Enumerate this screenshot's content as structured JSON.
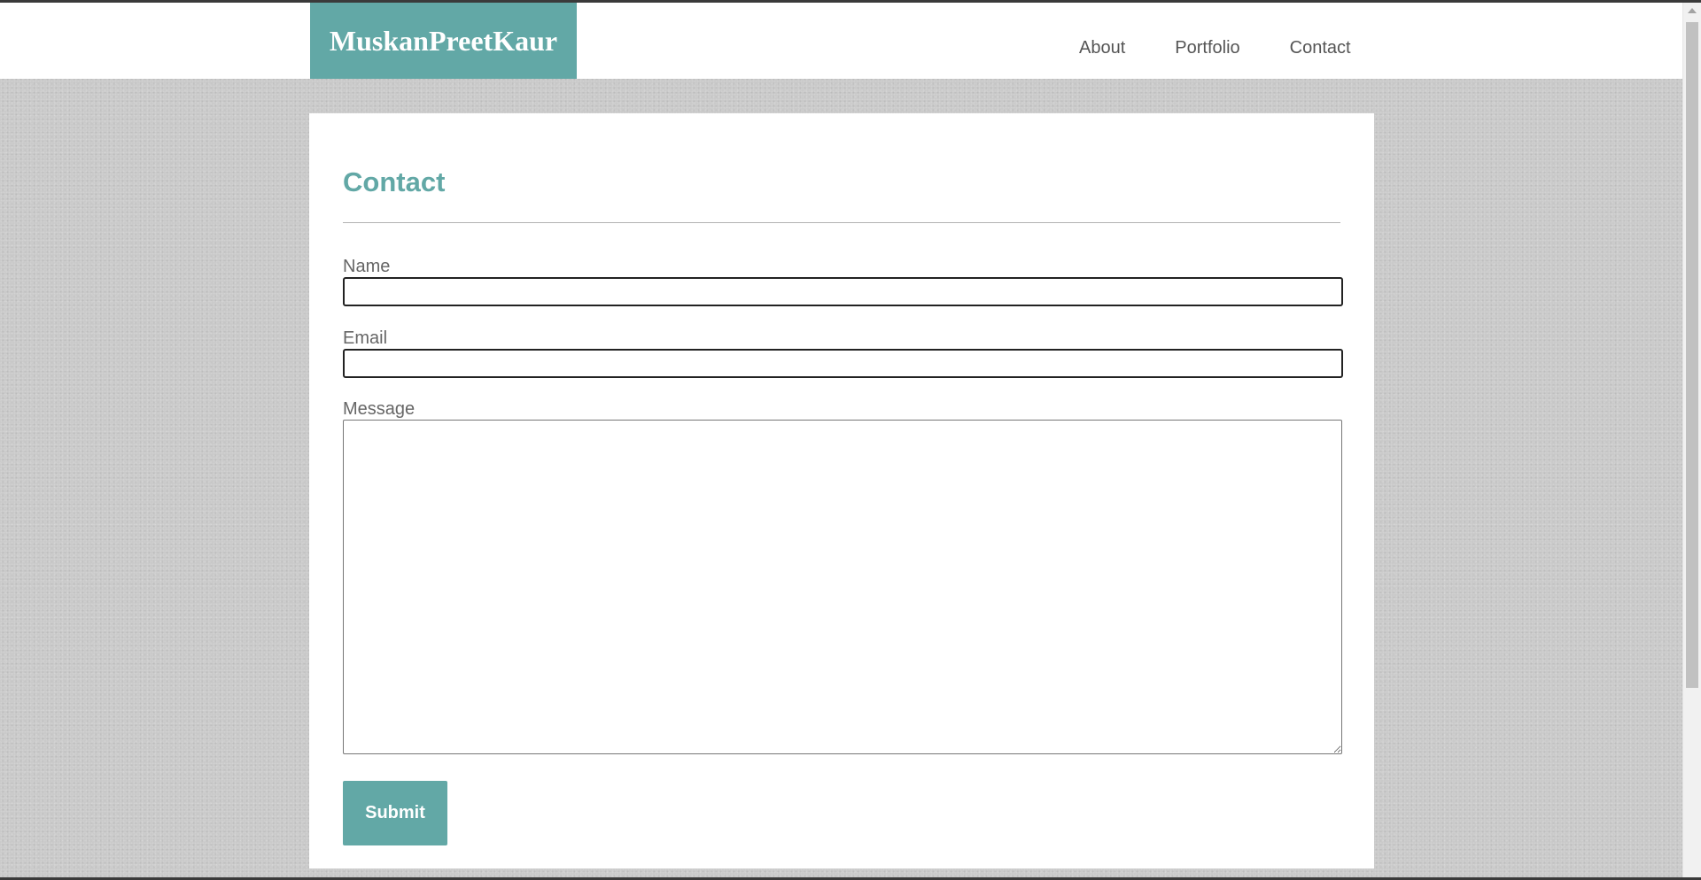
{
  "header": {
    "logo_text": "MuskanPreetKaur",
    "nav": {
      "about": "About",
      "portfolio": "Portfolio",
      "contact": "Contact"
    }
  },
  "main": {
    "title": "Contact",
    "form": {
      "name_label": "Name",
      "name_value": "",
      "email_label": "Email",
      "email_value": "",
      "message_label": "Message",
      "message_value": "",
      "submit_label": "Submit"
    }
  },
  "colors": {
    "accent": "#62a8a6",
    "background": "#c8c8c8",
    "text_muted": "#666666"
  }
}
